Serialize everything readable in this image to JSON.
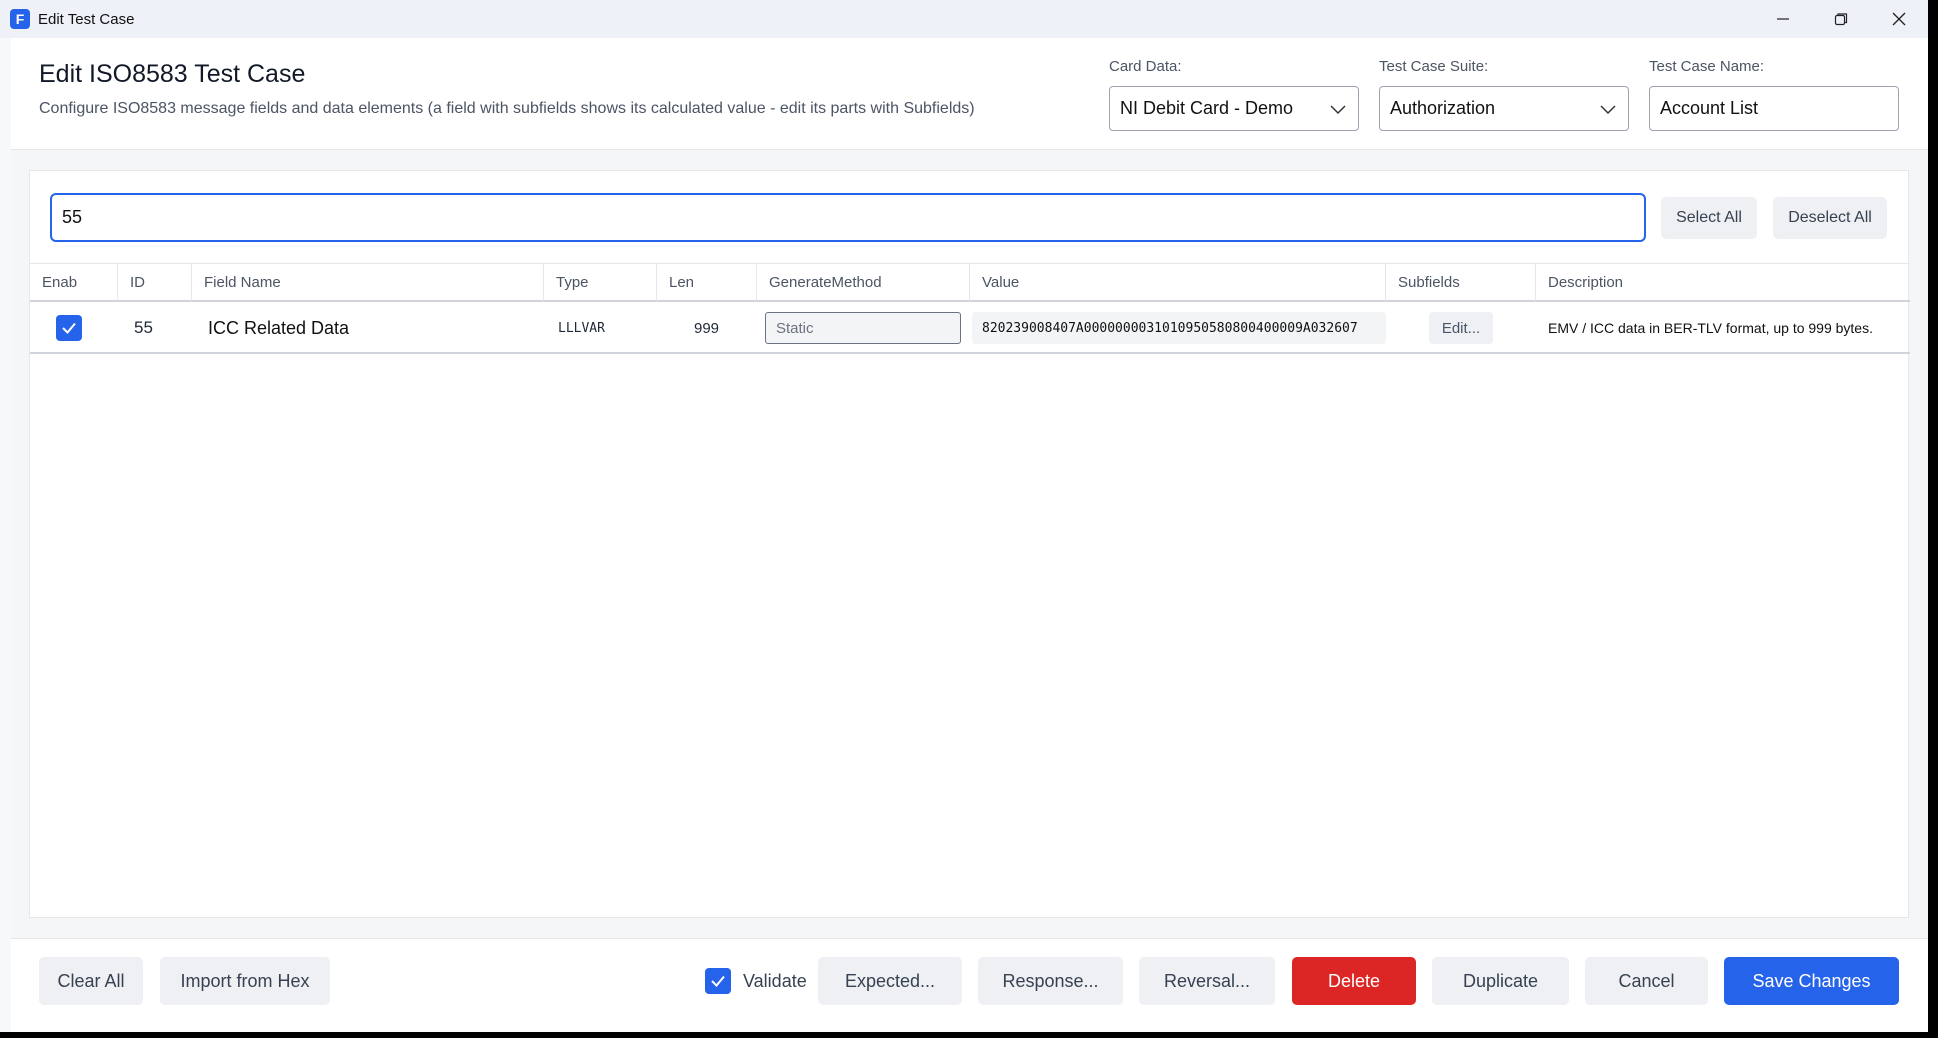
{
  "window": {
    "title": "Edit Test Case",
    "app_icon_letter": "F"
  },
  "header": {
    "title": "Edit ISO8583 Test Case",
    "subtitle": "Configure ISO8583 message fields and data elements (a field with subfields shows its calculated value - edit its parts with Subfields)",
    "card_data": {
      "label": "Card Data:",
      "value": "NI Debit Card - Demo"
    },
    "suite": {
      "label": "Test Case Suite:",
      "value": "Authorization"
    },
    "name": {
      "label": "Test Case Name:",
      "value": "Account List"
    }
  },
  "search": {
    "value": "55"
  },
  "toolbar": {
    "select_all": "Select All",
    "deselect_all": "Deselect All"
  },
  "table": {
    "columns": [
      "Enab",
      "ID",
      "Field Name",
      "Type",
      "Len",
      "GenerateMethod",
      "Value",
      "Subfields",
      "Description"
    ],
    "rows": [
      {
        "enabled": true,
        "id": "55",
        "field_name": "ICC Related Data",
        "type": "LLLVAR",
        "len": "999",
        "generate_method": "Static",
        "value": "820239008407A0000000031010950580800400009A032607",
        "subfields": "Edit...",
        "description": "EMV / ICC data in BER-TLV format, up to 999 bytes."
      }
    ]
  },
  "footer": {
    "clear_all": "Clear All",
    "import_hex": "Import from Hex",
    "validate": "Validate",
    "validate_checked": true,
    "expected": "Expected...",
    "response": "Response...",
    "reversal": "Reversal...",
    "delete": "Delete",
    "duplicate": "Duplicate",
    "cancel": "Cancel",
    "save": "Save Changes"
  },
  "colors": {
    "accent": "#2563eb",
    "danger": "#dc2626"
  }
}
